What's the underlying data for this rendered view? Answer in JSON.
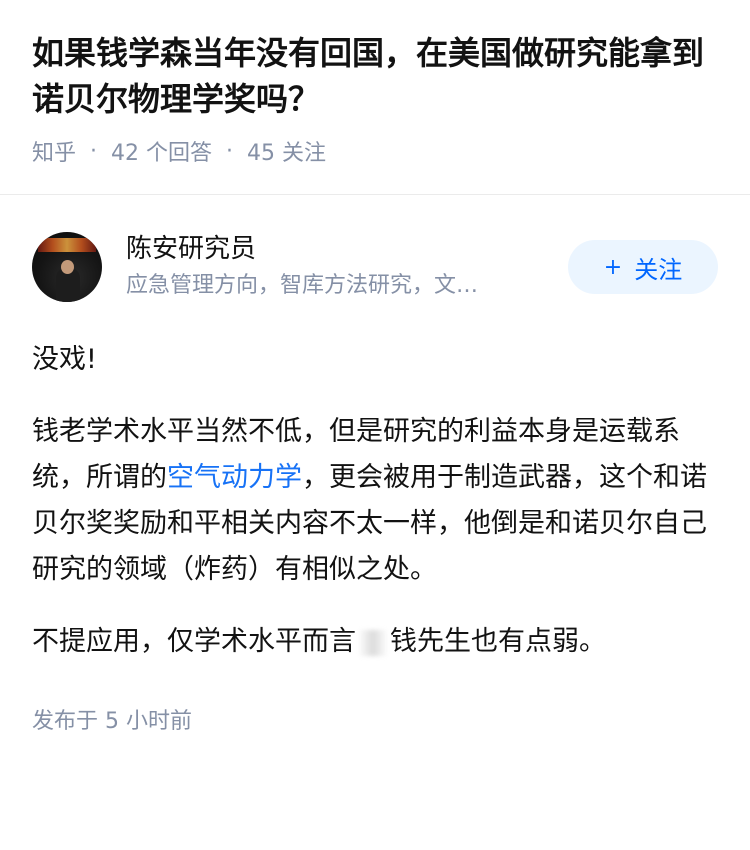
{
  "question": {
    "title": "如果钱学森当年没有回国，在美国做研究能拿到诺贝尔物理学奖吗？",
    "source": "知乎",
    "meta_dot": "·",
    "answers_count": "42 个回答",
    "followers_count": "45 关注"
  },
  "answer": {
    "author": {
      "name": "陈安研究员",
      "bio": "应急管理方向，智库方法研究，文…",
      "follow_icon": "+",
      "follow_label": "关注"
    },
    "paragraph1": "没戏!",
    "paragraph2_part1": "钱老学术水平当然不低，但是研究的利益本身是运载系统，所谓的",
    "paragraph2_link": "空气动力学",
    "paragraph2_part2": "，更会被用于制造武器，这个和诺贝尔奖奖励和平相关内容不太一样，他倒是和诺贝尔自己研究的领域（炸药）有相似之处。",
    "paragraph3_part1": "不提应用，仅学术水平而言",
    "paragraph3_part2": "钱先生也有点弱。",
    "published": "发布于  5 小时前"
  },
  "colors": {
    "accent": "#1772f6",
    "follow_bg": "#ebf5ff",
    "meta_gray": "#8590a6"
  }
}
